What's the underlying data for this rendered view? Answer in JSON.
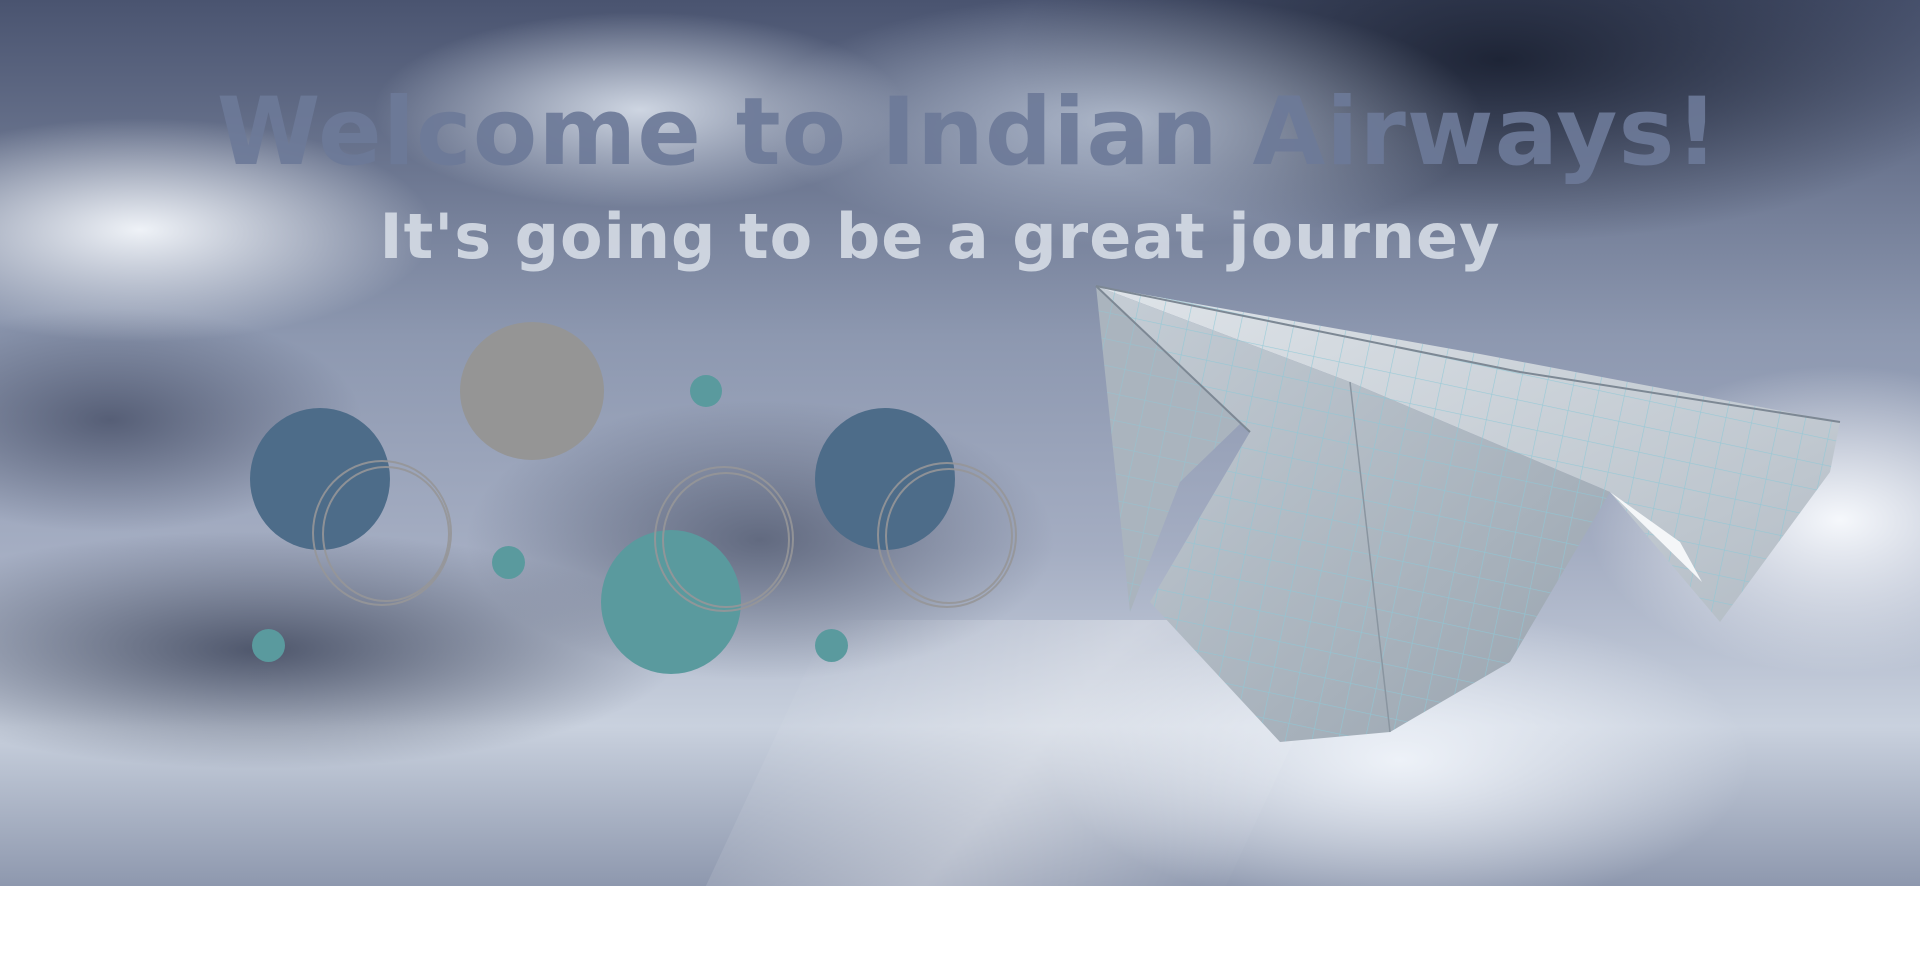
{
  "hero": {
    "title": "Welcome to Indian Airways!",
    "subtitle": "It's going to be a great journey"
  },
  "colors": {
    "title": "#6c7a98",
    "subtitle": "#d4dae4",
    "slate_blue": "#4d6c89",
    "teal": "#5a9a9e",
    "grey": "#959595",
    "ring": "#969698",
    "plane_paper": "#c6ced6",
    "plane_grid": "#8ec8d6"
  },
  "decorations": {
    "circle_colors": [
      "slate_blue",
      "grey",
      "teal"
    ],
    "ring_count": 3,
    "icon": "paper-plane-icon"
  }
}
